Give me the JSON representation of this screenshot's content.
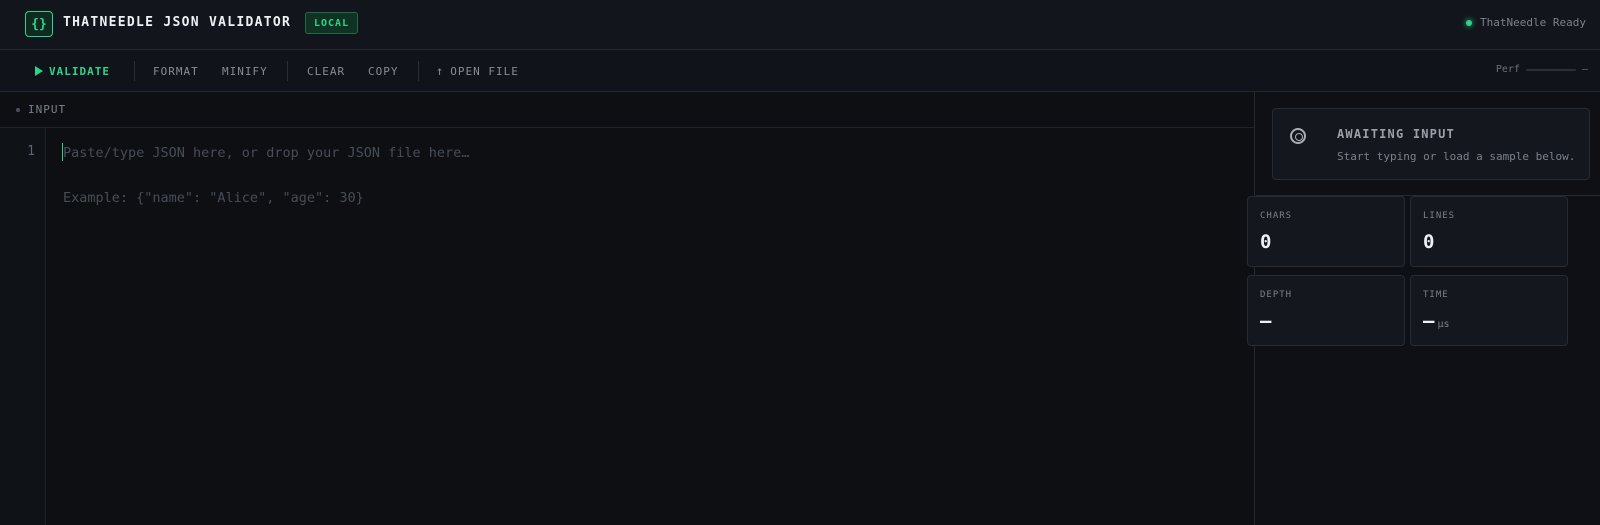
{
  "header": {
    "logo": "{}",
    "title": "THATNEEDLE JSON VALIDATOR",
    "badge": "LOCAL",
    "status": "ThatNeedle Ready"
  },
  "toolbar": {
    "validate": "VALIDATE",
    "format": "FORMAT",
    "minify": "MINIFY",
    "clear": "CLEAR",
    "copy": "COPY",
    "open_file": "OPEN FILE",
    "perf_label": "Perf",
    "perf_value": "—"
  },
  "editor": {
    "section_label": "INPUT",
    "line_number": "1",
    "placeholder": "Paste/type JSON here, or drop your JSON file here…",
    "example": "Example: {\"name\": \"Alice\", \"age\": 30}"
  },
  "panel": {
    "status_title": "AWAITING INPUT",
    "status_sub": "Start typing or load a sample below.",
    "stats": {
      "chars": {
        "label": "CHARS",
        "value": "0"
      },
      "lines": {
        "label": "LINES",
        "value": "0"
      },
      "depth": {
        "label": "DEPTH",
        "value": "—"
      },
      "time": {
        "label": "TIME",
        "value": "—",
        "unit": "µs"
      }
    }
  },
  "colors": {
    "accent": "#2fd28a",
    "background": "#0e1015",
    "surface": "#14171d"
  },
  "icons": {
    "logo": "braces-icon",
    "status": "status-dot-icon",
    "validate": "play-icon",
    "open_file": "arrow-up-icon",
    "awaiting": "target-icon"
  }
}
